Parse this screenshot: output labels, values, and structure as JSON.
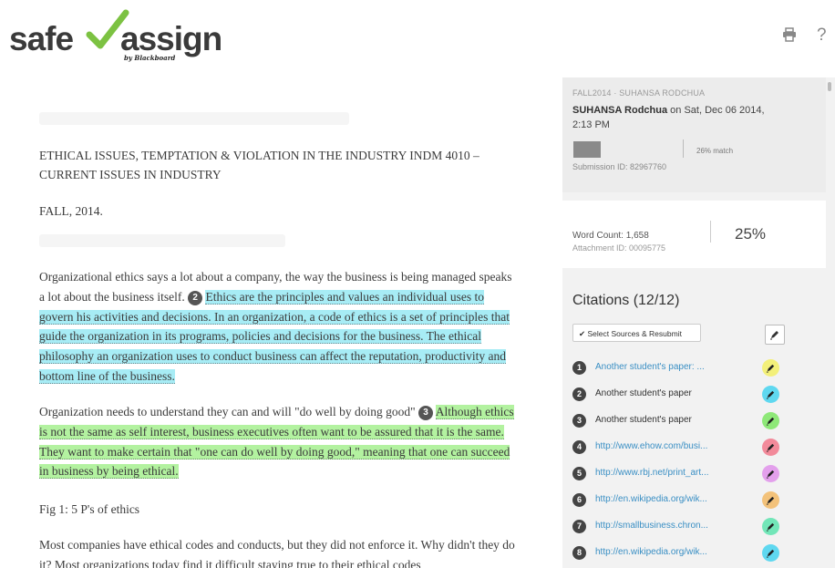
{
  "header": {
    "logo_left": "safe",
    "logo_right": "assign",
    "logo_by": "by Blackboard",
    "print_icon": "printer-icon",
    "help_label": "?"
  },
  "document": {
    "title": "ETHICAL ISSUES, TEMPTATION & VIOLATION IN THE INDUSTRY INDM 4010 – CURRENT ISSUES IN INDUSTRY",
    "term": "FALL, 2014.",
    "p1_plain": "Organizational ethics says a lot about a company, the way the business is being managed speaks a lot about the business itself.",
    "p1_badge": "2",
    "p1_highlight": "Ethics are the principles and values an individual uses to govern his activities and decisions. In an organization, a code of ethics is a set of principles that guide the organization in its programs, policies and decisions for the business. The ethical philosophy an organization uses to conduct business can affect the reputation, productivity and bottom line of the business.",
    "p2_plain": "Organization needs to understand they can and will \"do well by doing good\"",
    "p2_badge": "3",
    "p2_highlight": "Although ethics is not the same as self interest, business executives often want to be assured that it is the same. They want to make certain that \"one can do well by doing good,\" meaning that one can succeed in business by being ethical.",
    "fig_caption": "Fig 1: 5 P's of ethics",
    "p3": "Most companies have ethical codes and conducts, but they did not enforce it. Why didn't they do it? Most organizations today find it difficult staying true to their ethical codes"
  },
  "submission": {
    "meta": "FALL2014 · SUHANSA RODCHUA",
    "author": "SUHANSA Rodchua",
    "date_text": "on Sat, Dec 06 2014, 2:13 PM",
    "match": "26% match",
    "id": "Submission ID: 82967760"
  },
  "attachment": {
    "word_count": "Word Count: 1,658",
    "attachment_id": "Attachment ID: 00095775",
    "percent": "25%"
  },
  "citations": {
    "title": "Citations (12/12)",
    "select_button": "✔ Select Sources & Resubmit",
    "items": [
      {
        "num": "1",
        "text": "Another student's paper: ...",
        "color": "#f3f07a",
        "link": true
      },
      {
        "num": "2",
        "text": "Another student's paper",
        "color": "#5fd8f0",
        "link": false
      },
      {
        "num": "3",
        "text": "Another student's paper",
        "color": "#8ee878",
        "link": false
      },
      {
        "num": "4",
        "text": "http://www.ehow.com/busi...",
        "color": "#f28a9a",
        "link": true
      },
      {
        "num": "5",
        "text": "http://www.rbj.net/print_art...",
        "color": "#e3a0ec",
        "link": true
      },
      {
        "num": "6",
        "text": "http://en.wikipedia.org/wik...",
        "color": "#f3c27a",
        "link": true
      },
      {
        "num": "7",
        "text": "http://smallbusiness.chron...",
        "color": "#72e6b8",
        "link": true
      },
      {
        "num": "8",
        "text": "http://en.wikipedia.org/wik...",
        "color": "#5fd8f0",
        "link": true
      }
    ]
  },
  "colors": {
    "highlight_blue": "#a7ecf5",
    "highlight_green": "#b3f2a0",
    "logo_check": "#7cc242",
    "link": "#3a8fc4"
  }
}
